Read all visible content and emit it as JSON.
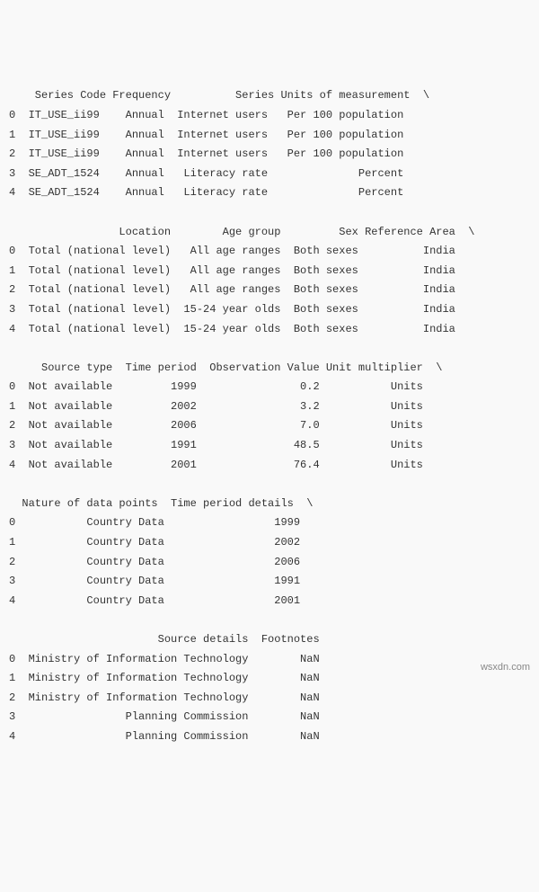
{
  "section1": {
    "header": "    Series Code Frequency          Series Units of measurement  \\",
    "rows": [
      "0  IT_USE_ii99    Annual  Internet users   Per 100 population",
      "1  IT_USE_ii99    Annual  Internet users   Per 100 population",
      "2  IT_USE_ii99    Annual  Internet users   Per 100 population",
      "3  SE_ADT_1524    Annual   Literacy rate              Percent",
      "4  SE_ADT_1524    Annual   Literacy rate              Percent"
    ]
  },
  "section2": {
    "header": "                 Location        Age group         Sex Reference Area  \\",
    "rows": [
      "0  Total (national level)   All age ranges  Both sexes          India",
      "1  Total (national level)   All age ranges  Both sexes          India",
      "2  Total (national level)   All age ranges  Both sexes          India",
      "3  Total (national level)  15-24 year olds  Both sexes          India",
      "4  Total (national level)  15-24 year olds  Both sexes          India"
    ]
  },
  "section3": {
    "header": "     Source type  Time period  Observation Value Unit multiplier  \\",
    "rows": [
      "0  Not available         1999                0.2           Units",
      "1  Not available         2002                3.2           Units",
      "2  Not available         2006                7.0           Units",
      "3  Not available         1991               48.5           Units",
      "4  Not available         2001               76.4           Units"
    ]
  },
  "section4": {
    "header": "  Nature of data points  Time period details  \\",
    "rows": [
      "0           Country Data                 1999",
      "1           Country Data                 2002",
      "2           Country Data                 2006",
      "3           Country Data                 1991",
      "4           Country Data                 2001"
    ]
  },
  "section5": {
    "header": "                       Source details  Footnotes",
    "rows": [
      "0  Ministry of Information Technology        NaN",
      "1  Ministry of Information Technology        NaN",
      "2  Ministry of Information Technology        NaN",
      "3                 Planning Commission        NaN",
      "4                 Planning Commission        NaN"
    ]
  },
  "watermark": "wsxdn.com"
}
